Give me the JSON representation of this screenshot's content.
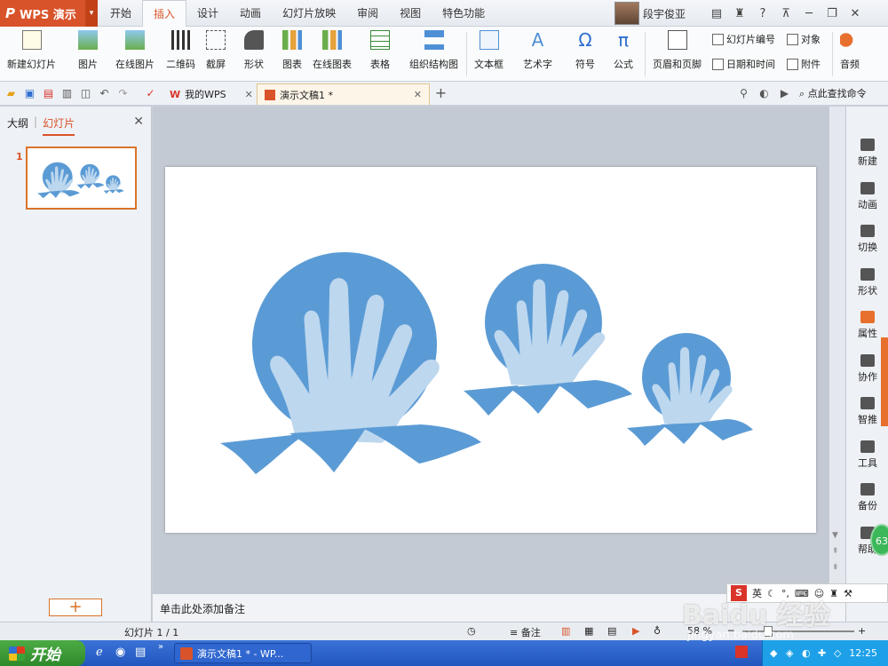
{
  "app": {
    "name": "WPS 演示",
    "logo_glyph": "P"
  },
  "ribbon_tabs": [
    "开始",
    "插入",
    "设计",
    "动画",
    "幻灯片放映",
    "审阅",
    "视图",
    "特色功能"
  ],
  "active_tab_index": 1,
  "user": {
    "name": "段宇俊亚"
  },
  "ribbon": {
    "new_slide": "新建幻灯片",
    "picture": "图片",
    "online_picture": "在线图片",
    "qrcode": "二维码",
    "screenshot": "截屏",
    "shapes": "形状",
    "chart": "图表",
    "online_chart": "在线图表",
    "table": "表格",
    "org_chart": "组织结构图",
    "textbox": "文本框",
    "wordart": "艺术字",
    "symbol": "符号",
    "formula": "公式",
    "header_footer": "页眉和页脚",
    "slide_number": "幻灯片编号",
    "object": "对象",
    "date_time": "日期和时间",
    "attachment": "附件",
    "audio": "音频",
    "dropdown_glyph": "▾"
  },
  "doc_tabs": [
    {
      "label": "我的WPS",
      "active": false
    },
    {
      "label": "演示文稿1 *",
      "active": true
    }
  ],
  "new_tab_glyph": "+",
  "command_search": "点此查找命令",
  "left_pane": {
    "outline_tab": "大纲",
    "slides_tab": "幻灯片",
    "slide_number": "1"
  },
  "notes_placeholder": "单击此处添加备注",
  "right_sidebar": [
    "新建",
    "动画",
    "切换",
    "形状",
    "属性",
    "协作",
    "智推",
    "工具",
    "备份",
    "帮助"
  ],
  "right_sidebar_active_index": 4,
  "badge": "63",
  "status": {
    "slide_counter": "幻灯片 1 / 1",
    "notes_button": "备注",
    "zoom": "58 %"
  },
  "taskbar": {
    "start_label": "开始",
    "task_label": "演示文稿1 * - WP...",
    "clock": "12:25"
  },
  "ime": {
    "logo": "S",
    "mode": "英"
  },
  "watermark": {
    "main": "Baidu 经验",
    "url": "jingyan.baidu.com"
  },
  "colors": {
    "accent": "#d9532a",
    "slide_shape_dark": "#5b9bd5",
    "slide_shape_light": "#bdd7ee",
    "taskbar": "#2256bf"
  }
}
